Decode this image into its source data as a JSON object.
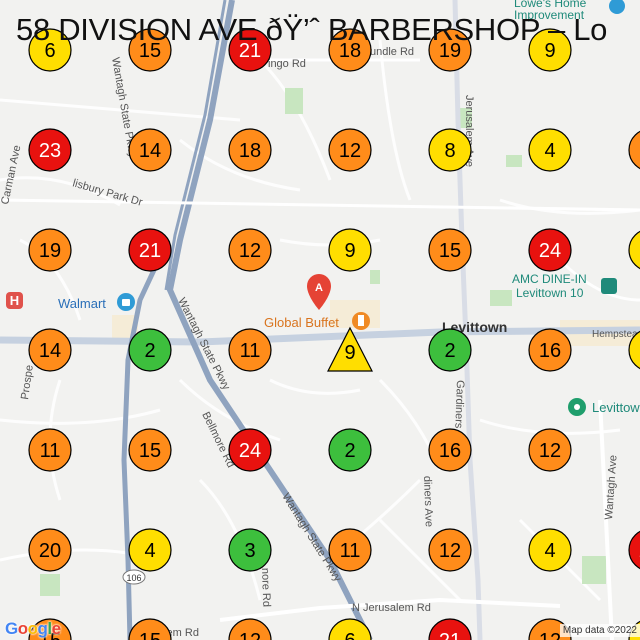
{
  "title": "58 DIVISION AVE ðŸ’ˆ BARBERSHOP – Lo",
  "attribution": "Map data ©2022",
  "google_logo": [
    "G",
    "o",
    "o",
    "g",
    "l",
    "e"
  ],
  "colors": {
    "red": "#e8120f",
    "orange": "#ff8c1a",
    "yellow": "#ffde00",
    "green": "#3dbf3d",
    "road_major": "#8fa3bf",
    "road_minor": "#ffffff",
    "park": "#c8e6c0",
    "bg": "#f2f2f0",
    "place_text": "#9a4d4d",
    "teal_text": "#1f8a7a"
  },
  "grid": {
    "cols": 7,
    "rows": [
      [
        6,
        15,
        21,
        18,
        19,
        9,
        null
      ],
      [
        23,
        14,
        18,
        12,
        8,
        4,
        null
      ],
      [
        19,
        21,
        12,
        9,
        15,
        24,
        null
      ],
      [
        14,
        2,
        11,
        "center",
        2,
        16,
        null
      ],
      [
        11,
        15,
        24,
        2,
        16,
        12,
        null
      ],
      [
        20,
        4,
        3,
        11,
        12,
        4,
        null
      ],
      [
        null,
        null,
        null,
        null,
        null,
        null,
        null
      ]
    ]
  },
  "center_marker": {
    "value": 9,
    "shape": "triangle"
  },
  "labels": {
    "lowes": "Lowe's Home Improvement",
    "walmart": "Walmart",
    "global_buffet": "Global Buffet",
    "levittown": "Levittown",
    "amc": "AMC DINE-IN Levittown 10",
    "levittown_poi": "Levittow",
    "hempstead": "Hempstead",
    "streets": {
      "wantagh_state_pkwy_1": "Wantagh State Pkwy",
      "wantagh_state_pkwy_2": "Wantagh State Pkwy",
      "wantagh_state_pkwy_3": "Wantagh State Pkwy",
      "jerusalem_ave": "Jerusalem Ave",
      "gardiners_ave": "Gardiners Ave",
      "gardiners_ave_2": "diners Ave",
      "bellmore_rd": "Bellmore Rd",
      "bellmore_rd_2": "nore Rd",
      "carman_ave": "Carman Ave",
      "prospect": "Prospe",
      "salisbury_park_dr": "lisbury Park Dr",
      "n_jerusalem_rd": "N Jerusalem Rd",
      "wantagh_ave": "Wantagh Ave",
      "mingo_rd": "ingo Rd",
      "undle_rd": "undle Rd",
      "emile_rd": "elem Rd",
      "route_106": "106"
    }
  }
}
